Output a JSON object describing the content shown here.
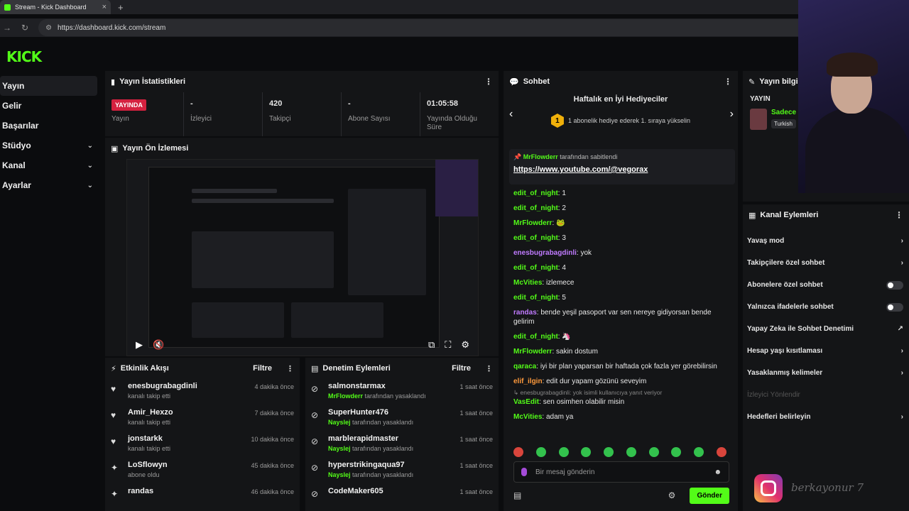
{
  "browser": {
    "tab_title": "Stream - Kick Dashboard",
    "url": "https://dashboard.kick.com/stream"
  },
  "brand": {
    "logo": "KICK",
    "accent": "#53fc18"
  },
  "sidebar": {
    "items": [
      {
        "label": "Yayın",
        "active": true
      },
      {
        "label": "Gelir"
      },
      {
        "label": "Başarılar"
      },
      {
        "label": "Stüdyo",
        "expandable": true
      },
      {
        "label": "Kanal",
        "expandable": true
      },
      {
        "label": "Ayarlar",
        "expandable": true
      }
    ]
  },
  "stats": {
    "title": "Yayın İstatistikleri",
    "live_badge": "YAYINDA",
    "items": [
      {
        "value": "",
        "label": "Yayın"
      },
      {
        "value": "-",
        "label": "İzleyici"
      },
      {
        "value": "420",
        "label": "Takipçi"
      },
      {
        "value": "-",
        "label": "Abone Sayısı"
      },
      {
        "value": "01:05:58",
        "label": "Yayında Olduğu Süre"
      }
    ]
  },
  "preview": {
    "title": "Yayın Ön İzlemesi"
  },
  "activity": {
    "title": "Etkinlik Akışı",
    "filter": "Filtre",
    "items": [
      {
        "name": "enesbugrabagdinli",
        "desc": "kanalı takip etti",
        "time": "4 dakika önce",
        "icon": "heart-icon"
      },
      {
        "name": "Amir_Hexzo",
        "desc": "kanalı takip etti",
        "time": "7 dakika önce",
        "icon": "heart-icon"
      },
      {
        "name": "jonstarkk",
        "desc": "kanalı takip etti",
        "time": "10 dakika önce",
        "icon": "heart-icon"
      },
      {
        "name": "LoSflowyn",
        "desc": "abone oldu",
        "time": "45 dakika önce",
        "icon": "star-icon"
      },
      {
        "name": "randas",
        "desc": "",
        "time": "46 dakika önce",
        "icon": "star-icon"
      }
    ]
  },
  "audit": {
    "title": "Denetim Eylemleri",
    "filter": "Filtre",
    "items": [
      {
        "name": "salmonstarmax",
        "by": "MrFlowderr",
        "desc": "tarafından yasaklandı",
        "time": "1 saat önce"
      },
      {
        "name": "SuperHunter476",
        "by": "Nayslej",
        "desc": "tarafından yasaklandı",
        "time": "1 saat önce"
      },
      {
        "name": "marblerapidmaster",
        "by": "Nayslej",
        "desc": "tarafından yasaklandı",
        "time": "1 saat önce"
      },
      {
        "name": "hyperstrikingaqua97",
        "by": "Nayslej",
        "desc": "tarafından yasaklandı",
        "time": "1 saat önce"
      },
      {
        "name": "CodeMaker605",
        "by": "",
        "desc": "",
        "time": "1 saat önce"
      }
    ]
  },
  "chat": {
    "title": "Sohbet",
    "gifters_title": "Haftalık en İyi Hediyeciler",
    "gifters_rank": "1",
    "gifters_sub": "1 abonelik hediye ederek 1. sıraya yükselin",
    "pinned_by": "MrFlowderr",
    "pinned_label": "tarafından sabitlendi",
    "pinned_link": "https://www.youtube.com/@vegorax",
    "messages": [
      {
        "user": "edit_of_night",
        "color": "#53fc18",
        "text": "1"
      },
      {
        "user": "edit_of_night",
        "color": "#53fc18",
        "text": "2"
      },
      {
        "user": "MrFlowderr",
        "color": "#53fc18",
        "text": ""
      },
      {
        "user": "edit_of_night",
        "color": "#53fc18",
        "text": "3"
      },
      {
        "user": "enesbugrabagdinli",
        "color": "#c07bff",
        "text": "yok"
      },
      {
        "user": "edit_of_night",
        "color": "#53fc18",
        "text": "4"
      },
      {
        "user": "McVities",
        "color": "#53fc18",
        "text": "izlemece"
      },
      {
        "user": "edit_of_night",
        "color": "#53fc18",
        "text": "5"
      },
      {
        "user": "randas",
        "color": "#c07bff",
        "text": "bende yeşil pasoport var sen nereye gidiyorsan bende gelirim"
      },
      {
        "user": "edit_of_night",
        "color": "#53fc18",
        "text": ""
      },
      {
        "user": "MrFlowderr",
        "color": "#53fc18",
        "text": "sakin dostum"
      },
      {
        "user": "qaraca",
        "color": "#53fc18",
        "text": "iyi bir plan yaparsan bir haftada çok fazla yer görebilirsin"
      },
      {
        "user": "elif_ilgin",
        "color": "#ff9a3c",
        "text": "edit dur yapam gözünü seveyim"
      },
      {
        "user": "VasEdit",
        "color": "#53fc18",
        "text": "sen osimhen olabilir misin",
        "reply": "enesbugrabagdinli: yok isimli kullanıcıya yanıt veriyor"
      },
      {
        "user": "McVities",
        "color": "#53fc18",
        "text": "adam ya"
      }
    ],
    "input_placeholder": "Bir mesaj gönderin",
    "send_label": "Gönder"
  },
  "info": {
    "title": "Yayın bilgisi",
    "label": "YAYIN",
    "name": "Sadece",
    "tag": "Turkish"
  },
  "actions": {
    "title": "Kanal Eylemleri",
    "items": [
      {
        "label": "Yavaş mod",
        "control": "chevron"
      },
      {
        "label": "Takipçilere özel sohbet",
        "control": "chevron"
      },
      {
        "label": "Abonelere özel sohbet",
        "control": "toggle"
      },
      {
        "label": "Yalnızca ifadelerle sohbet",
        "control": "toggle"
      },
      {
        "label": "Yapay Zeka ile Sohbet Denetimi",
        "control": "external"
      },
      {
        "label": "Hesap yaşı kısıtlaması",
        "control": "chevron"
      },
      {
        "label": "Yasaklanmış kelimeler",
        "control": "chevron"
      },
      {
        "label": "İzleyici Yönlendir",
        "control": "none",
        "disabled": true
      },
      {
        "label": "Hedefleri belirleyin",
        "control": "chevron"
      }
    ]
  },
  "overlay": {
    "watermark": "berkayonur 7"
  }
}
